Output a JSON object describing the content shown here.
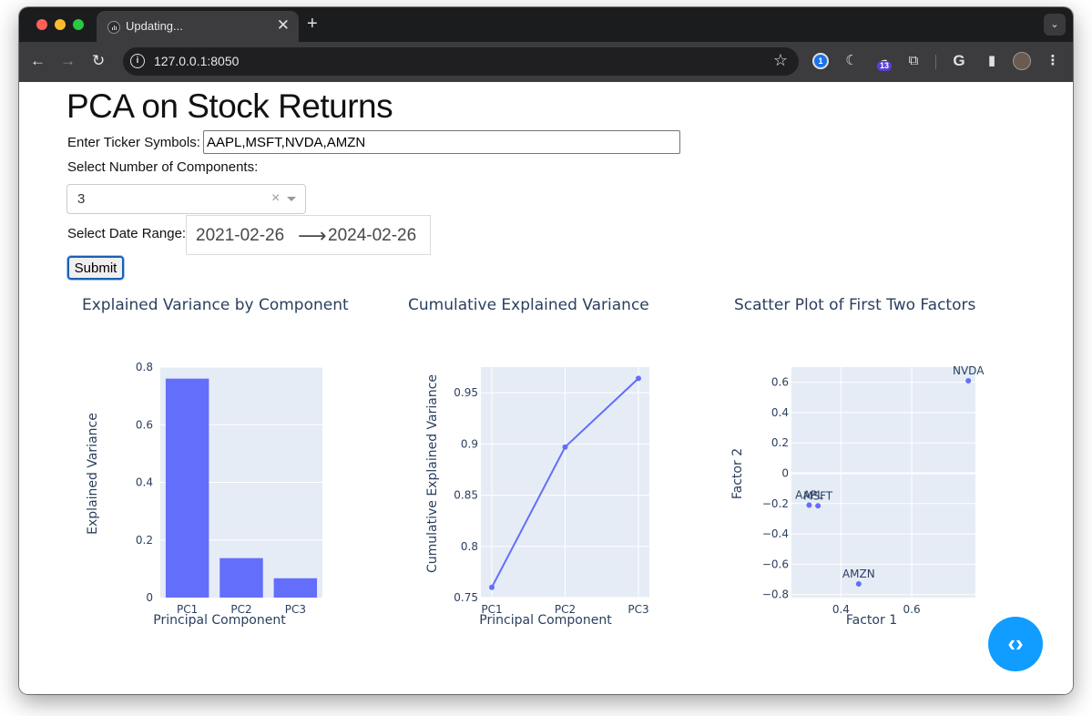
{
  "browser": {
    "tab_title": "Updating...",
    "url": "127.0.0.1:8050",
    "extension_badge": "13"
  },
  "page": {
    "title": "PCA on Stock Returns",
    "ticker_label": "Enter Ticker Symbols:",
    "ticker_value": "AAPL,MSFT,NVDA,AMZN",
    "components_label": "Select Number of Components:",
    "components_value": "3",
    "date_label": "Select Date Range:",
    "start_date": "2021-02-26",
    "end_date": "2024-02-26",
    "submit_label": "Submit"
  },
  "colors": {
    "accent": "#636efa",
    "plot_bg": "#e5ecf6",
    "fab": "#119dff"
  },
  "chart_data": [
    {
      "type": "bar",
      "title": "Explained Variance by Component",
      "xlabel": "Principal Component",
      "ylabel": "Explained Variance",
      "categories": [
        "PC1",
        "PC2",
        "PC3"
      ],
      "values": [
        0.76,
        0.137,
        0.067
      ],
      "ylim": [
        0,
        0.8
      ],
      "yticks": [
        "0",
        "0.2",
        "0.4",
        "0.6",
        "0.8"
      ],
      "ytick_values": [
        0,
        0.2,
        0.4,
        0.6,
        0.8
      ],
      "grid": true
    },
    {
      "type": "line",
      "title": "Cumulative Explained Variance",
      "xlabel": "Principal Component",
      "ylabel": "Cumulative Explained Variance",
      "categories": [
        "PC1",
        "PC2",
        "PC3"
      ],
      "values": [
        0.76,
        0.897,
        0.964
      ],
      "ylim": [
        0.75,
        0.975
      ],
      "yticks": [
        "0.75",
        "0.8",
        "0.85",
        "0.9",
        "0.95"
      ],
      "ytick_values": [
        0.75,
        0.8,
        0.85,
        0.9,
        0.95
      ],
      "grid": true
    },
    {
      "type": "scatter",
      "title": "Scatter Plot of First Two Factors",
      "xlabel": "Factor 1",
      "ylabel": "Factor 2",
      "points": [
        {
          "label": "AAPL",
          "x": 0.31,
          "y": -0.21
        },
        {
          "label": "MSFT",
          "x": 0.335,
          "y": -0.215
        },
        {
          "label": "NVDA",
          "x": 0.76,
          "y": 0.61
        },
        {
          "label": "AMZN",
          "x": 0.45,
          "y": -0.73
        }
      ],
      "xlim": [
        0.26,
        0.78
      ],
      "ylim": [
        -0.82,
        0.7
      ],
      "xticks": [
        "0.4",
        "0.6"
      ],
      "xtick_values": [
        0.4,
        0.6
      ],
      "yticks": [
        "0.6",
        "0.4",
        "0.2",
        "0",
        "−0.2",
        "−0.4",
        "−0.6",
        "−0.8"
      ],
      "ytick_values": [
        0.6,
        0.4,
        0.2,
        0,
        -0.2,
        -0.4,
        -0.6,
        -0.8
      ],
      "grid": true
    }
  ]
}
